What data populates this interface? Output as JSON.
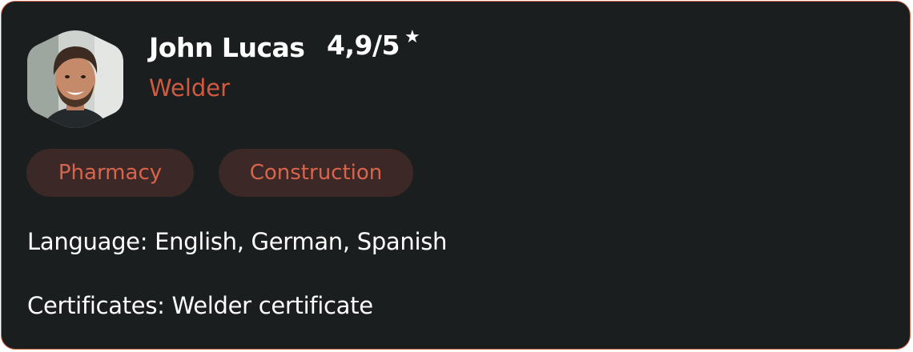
{
  "profile": {
    "name": "John Lucas",
    "rating": "4,9/5",
    "rating_icon": "star-icon",
    "role": "Welder",
    "avatar": "avatar-photo"
  },
  "tags": [
    "Pharmacy",
    "Construction"
  ],
  "details": {
    "language": "Language: English, German, Spanish",
    "certificates": "Certificates: Welder certificate"
  },
  "colors": {
    "background": "#1b1e1f",
    "border": "#d2664a",
    "accent": "#d05a3f",
    "tag_background": "#3c2927",
    "text": "#ffffff"
  }
}
